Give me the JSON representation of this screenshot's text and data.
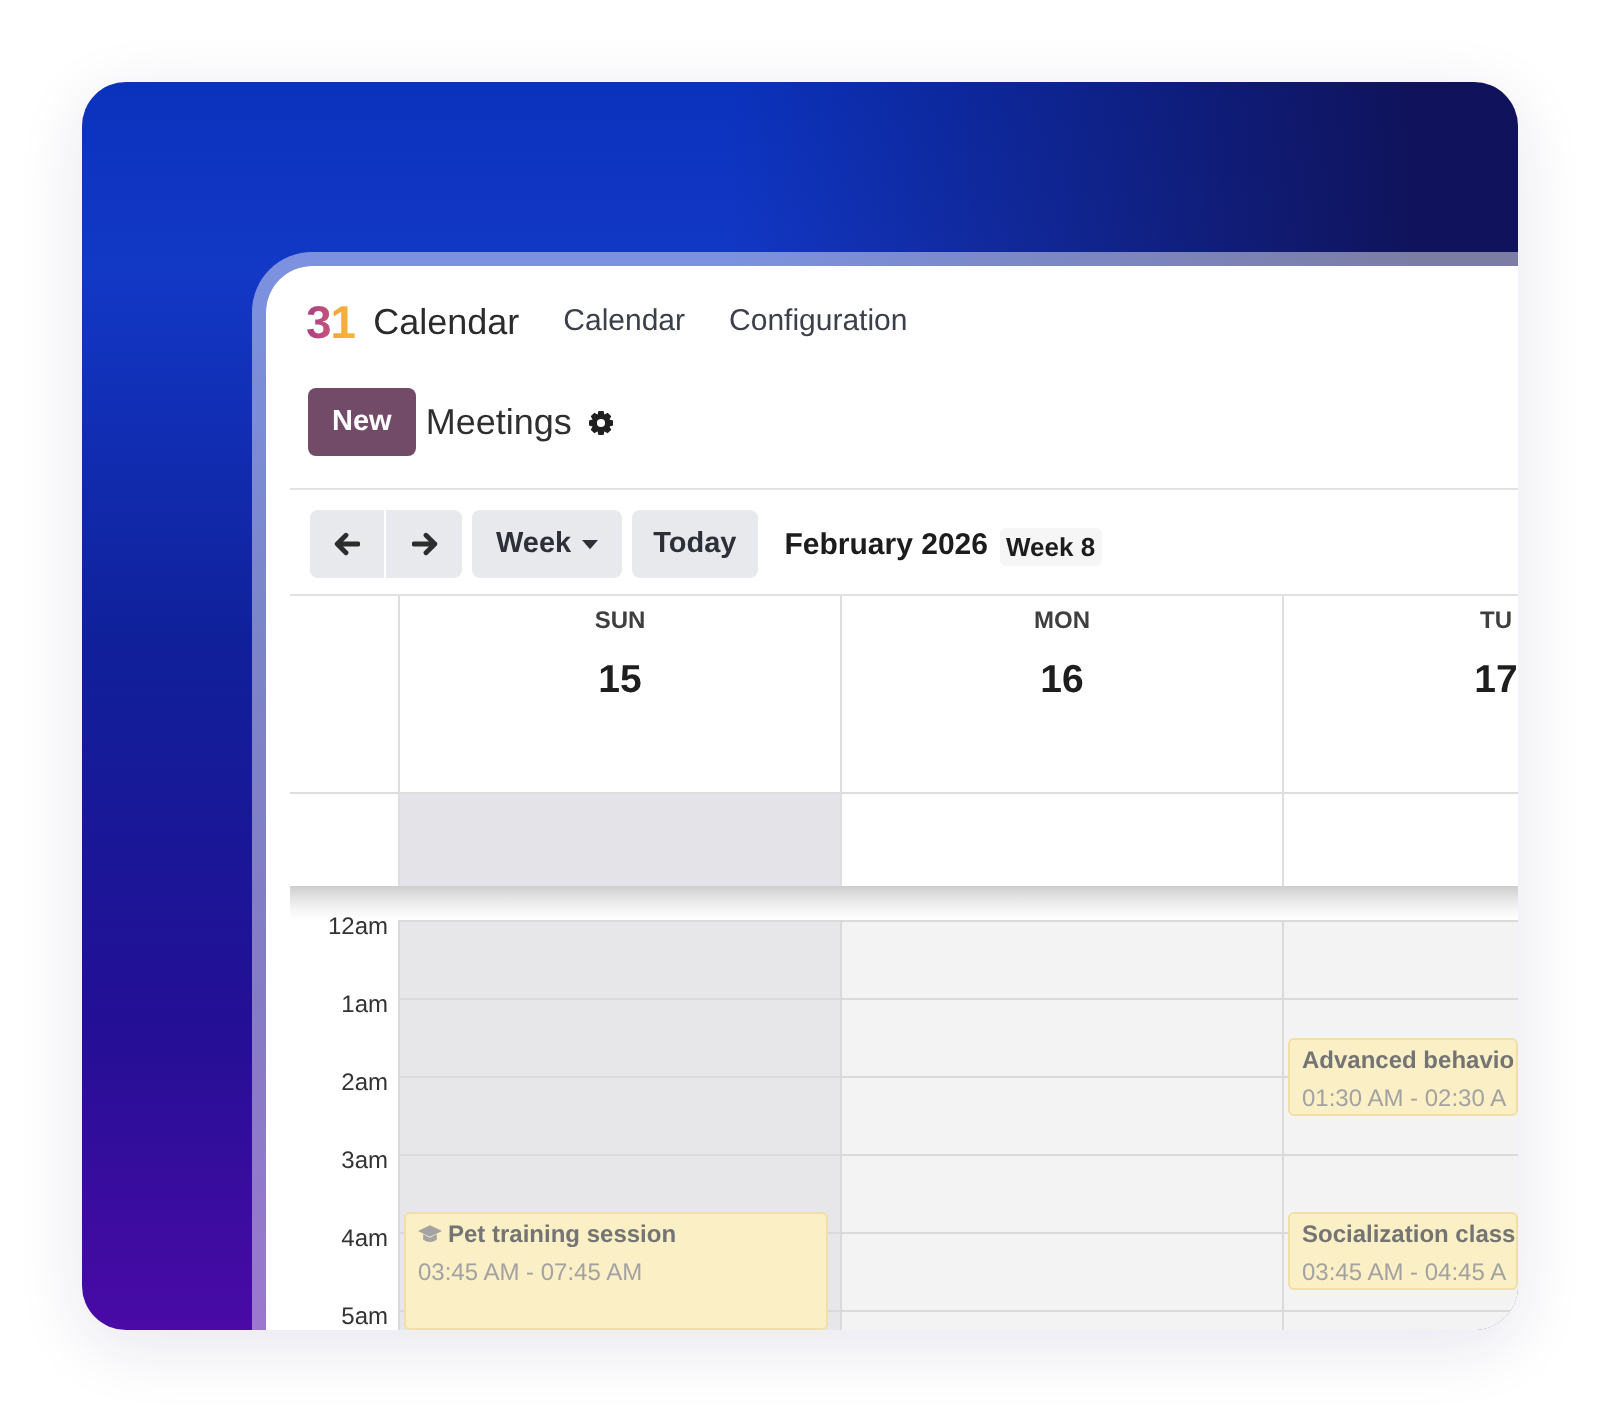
{
  "app": {
    "logo": "31",
    "name": "Calendar"
  },
  "menu": [
    {
      "label": "Calendar"
    },
    {
      "label": "Configuration"
    }
  ],
  "control_panel": {
    "new_button": "New",
    "title": "Meetings"
  },
  "toolbar": {
    "scale": "Week",
    "today": "Today",
    "period": "February 2026",
    "week_number": "Week 8"
  },
  "days": [
    {
      "name": "SUN",
      "date": "15",
      "weekend": true,
      "events": [
        {
          "title": "Pet training session",
          "time": "03:45 AM - 07:45 AM",
          "icon": true
        }
      ]
    },
    {
      "name": "MON",
      "date": "16",
      "weekend": false
    },
    {
      "name": "TU",
      "date": "17",
      "weekend": false,
      "events": [
        {
          "title": "Advanced behavio",
          "time": "01:30 AM - 02:30 A",
          "icon": false
        },
        {
          "title": "Socialization class",
          "time": "03:45 AM - 04:45 A",
          "icon": false
        }
      ]
    }
  ],
  "hours": [
    "12am",
    "1am",
    "2am",
    "3am",
    "4am",
    "5am"
  ]
}
